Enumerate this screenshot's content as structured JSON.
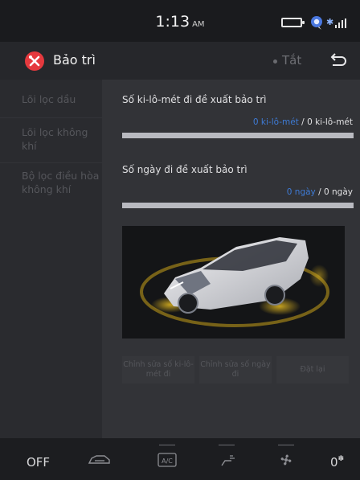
{
  "status_bar": {
    "time": "1:13",
    "ampm": "AM"
  },
  "header": {
    "title": "Bảo trì",
    "status_label": "Tắt",
    "app_icon": "wrench-screwdriver-icon",
    "back_icon": "return-arrow-icon"
  },
  "sidebar": {
    "items": [
      {
        "label": "Lõi lọc dầu"
      },
      {
        "label": "Lõi lọc không khí"
      },
      {
        "label": "Bộ lọc điều hòa không khí"
      }
    ]
  },
  "main": {
    "km_section": {
      "title": "Số ki-lô-mét đi đề xuất bảo trì",
      "current": "0 ki-lô-mét",
      "separator": "/",
      "target": "0 ki-lô-mét",
      "progress": 0
    },
    "days_section": {
      "title": "Số ngày đi đề xuất bảo trì",
      "current": "0 ngày",
      "separator": "/",
      "target": "0 ngày",
      "progress": 0
    },
    "buttons": {
      "edit_km": "Chỉnh sửa số ki-lô-mét đi",
      "edit_days": "Chỉnh sửa số ngày đi",
      "reset": "Đặt lại"
    }
  },
  "bottom_bar": {
    "off_label": "OFF",
    "fan_level": "0",
    "icons": [
      "car-recirculation-icon",
      "ac-icon",
      "seat-airflow-icon",
      "fan-icon"
    ],
    "ac_label": "A/C"
  },
  "colors": {
    "accent": "#3e7bd6",
    "app_icon_red": "#e5393e"
  }
}
